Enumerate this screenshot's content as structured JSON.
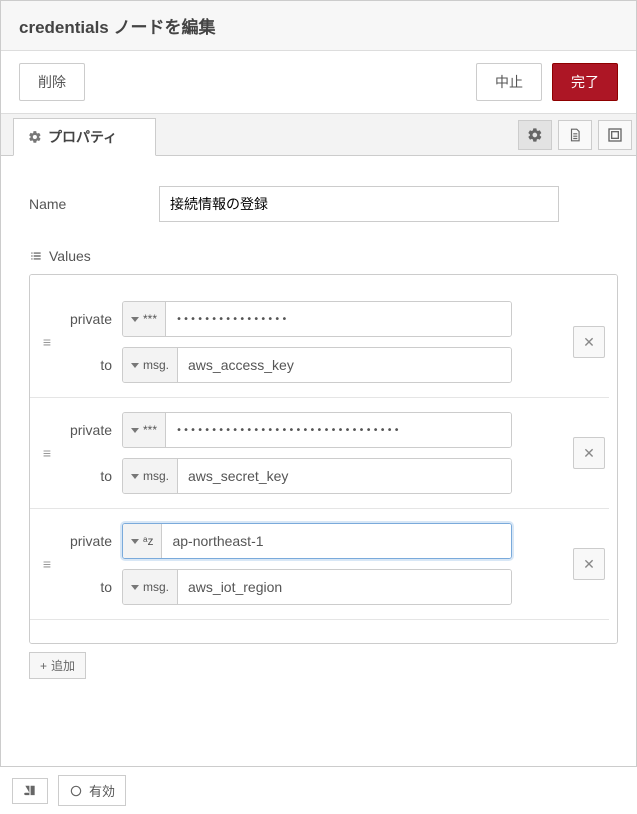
{
  "header": {
    "title": "credentials ノードを編集"
  },
  "actions": {
    "delete": "削除",
    "cancel": "中止",
    "done": "完了"
  },
  "tabs": {
    "properties": "プロパティ"
  },
  "form": {
    "name_label": "Name",
    "name_value": "接続情報の登録",
    "values_label": "Values",
    "add_label": "追加"
  },
  "type_labels": {
    "password": "***",
    "string_az": "ᵃz",
    "msg": "msg."
  },
  "values": [
    {
      "private_label": "private",
      "private_type": "password",
      "private_value": "••••••••••••••••",
      "to_label": "to",
      "to_type": "msg",
      "to_value": "aws_access_key"
    },
    {
      "private_label": "private",
      "private_type": "password",
      "private_value": "••••••••••••••••••••••••••••••••",
      "to_label": "to",
      "to_type": "msg",
      "to_value": "aws_secret_key"
    },
    {
      "private_label": "private",
      "private_type": "string",
      "private_value": "ap-northeast-1",
      "to_label": "to",
      "to_type": "msg",
      "to_value": "aws_iot_region",
      "focused": true
    }
  ],
  "footer": {
    "enabled_label": "有効"
  }
}
